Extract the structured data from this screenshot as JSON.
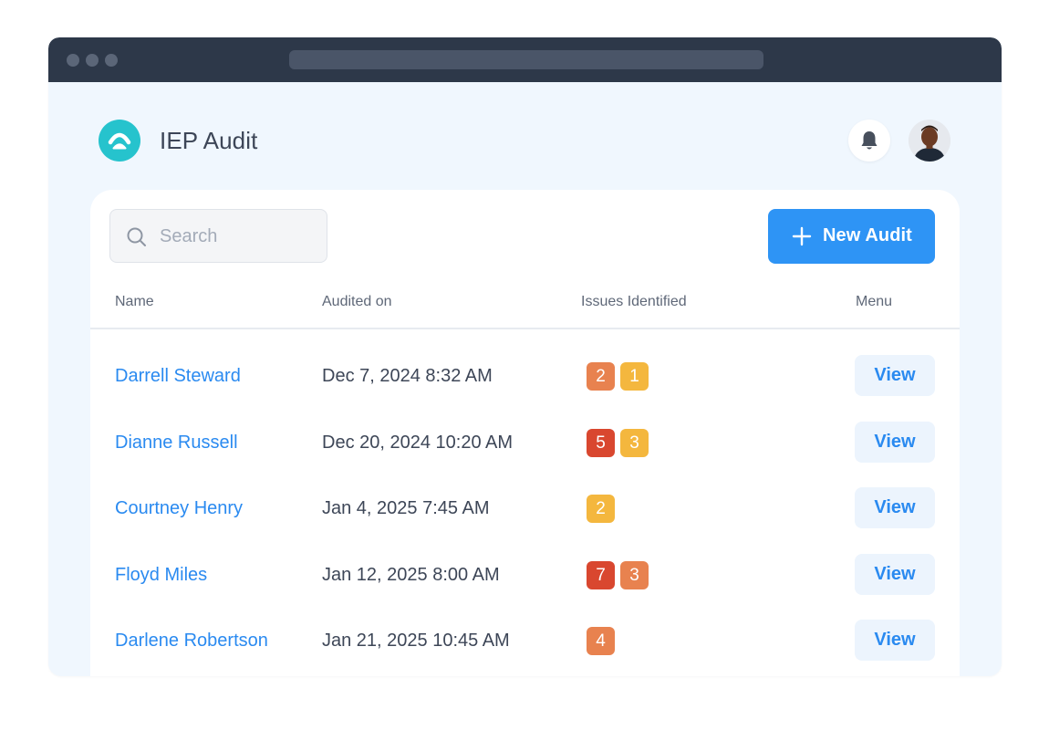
{
  "app": {
    "title": "IEP Audit"
  },
  "search": {
    "placeholder": "Search"
  },
  "toolbar": {
    "new_label": "New Audit"
  },
  "table": {
    "columns": [
      "Name",
      "Audited on",
      "Issues Identified",
      "Menu"
    ],
    "rows": [
      {
        "name": "Darrell Steward",
        "date": "Dec 7, 2024",
        "time": "8:32 AM",
        "issues": [
          {
            "count": "2",
            "level": "orange"
          },
          {
            "count": "1",
            "level": "yellow"
          }
        ],
        "action": "View"
      },
      {
        "name": "Dianne Russell",
        "date": "Dec 20, 2024",
        "time": "10:20 AM",
        "issues": [
          {
            "count": "5",
            "level": "red"
          },
          {
            "count": "3",
            "level": "yellow"
          }
        ],
        "action": "View"
      },
      {
        "name": "Courtney Henry",
        "date": "Jan 4, 2025",
        "time": "7:45 AM",
        "issues": [
          {
            "count": "2",
            "level": "yellow"
          }
        ],
        "action": "View"
      },
      {
        "name": "Floyd Miles",
        "date": "Jan 12, 2025",
        "time": "8:00 AM",
        "issues": [
          {
            "count": "7",
            "level": "red"
          },
          {
            "count": "3",
            "level": "orange"
          }
        ],
        "action": "View"
      },
      {
        "name": "Darlene Robertson",
        "date": "Jan 21, 2025",
        "time": "10:45 AM",
        "issues": [
          {
            "count": "4",
            "level": "orange"
          }
        ],
        "action": "View"
      }
    ]
  },
  "colors": {
    "accent": "#2e94f5",
    "link": "#2a8af0",
    "logo": "#26c3cd",
    "titlebar": "#2d3849",
    "badge_red": "#d9472f",
    "badge_orange": "#e8824f",
    "badge_yellow": "#f4b73e"
  },
  "icons": {
    "logo": "circle-logo-icon",
    "bell": "bell-icon",
    "search": "search-icon",
    "add": "plus-icon"
  }
}
